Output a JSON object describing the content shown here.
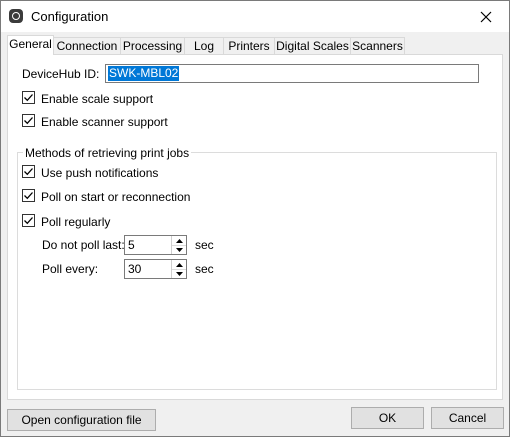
{
  "window": {
    "title": "Configuration"
  },
  "tabs": [
    {
      "label": "General",
      "active": true
    },
    {
      "label": "Connection",
      "active": false
    },
    {
      "label": "Processing",
      "active": false
    },
    {
      "label": "Log",
      "active": false
    },
    {
      "label": "Printers",
      "active": false
    },
    {
      "label": "Digital Scales",
      "active": false
    },
    {
      "label": "Scanners",
      "active": false
    }
  ],
  "general": {
    "device_id_label": "DeviceHub ID:",
    "device_id_value": "SWK-MBL02",
    "enable_scale_label": "Enable scale support",
    "enable_scale_checked": true,
    "enable_scanner_label": "Enable scanner support",
    "enable_scanner_checked": true
  },
  "methods": {
    "group_title": "Methods of retrieving print jobs",
    "push_label": "Use push notifications",
    "push_checked": true,
    "poll_start_label": "Poll on start or reconnection",
    "poll_start_checked": true,
    "poll_regularly_label": "Poll regularly",
    "poll_regularly_checked": true,
    "do_not_poll_label": "Do not poll last:",
    "do_not_poll_value": "5",
    "do_not_poll_unit": "sec",
    "poll_every_label": "Poll every:",
    "poll_every_value": "30",
    "poll_every_unit": "sec"
  },
  "buttons": {
    "open_config": "Open configuration file",
    "ok": "OK",
    "cancel": "Cancel"
  },
  "colors": {
    "selection": "#0078d7",
    "button_face": "#e1e1e1"
  }
}
